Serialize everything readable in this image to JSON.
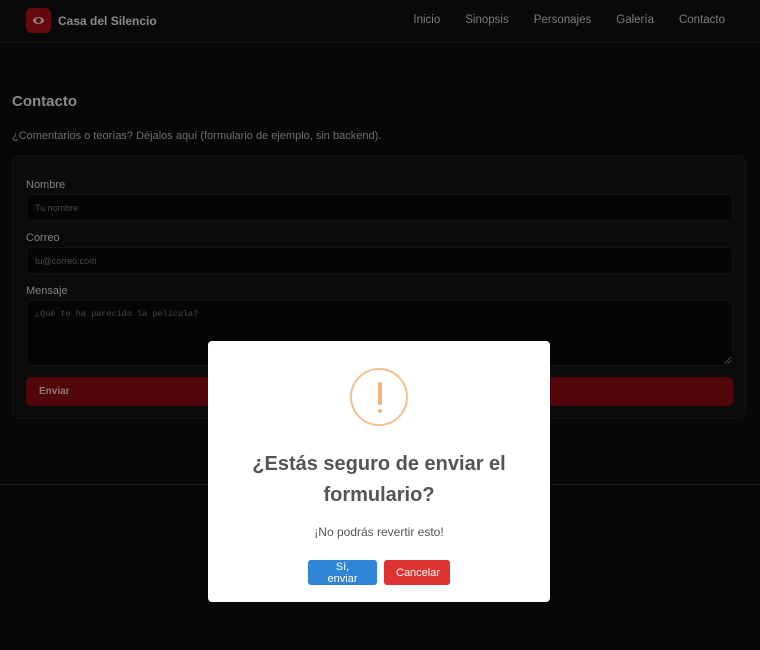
{
  "header": {
    "brand": "Casa del Silencio",
    "nav": [
      "Inicio",
      "Sinopsis",
      "Personajes",
      "Galería",
      "Contacto"
    ]
  },
  "contact": {
    "title": "Contacto",
    "description": "¿Comentarios o teorías? Déjalos aquí (formulario de ejemplo, sin backend).",
    "name_label": "Nombre",
    "name_placeholder": "Tu nombre",
    "email_label": "Correo",
    "email_placeholder": "tu@correo.com",
    "message_label": "Mensaje",
    "message_placeholder": "¿Qué te ha parecido la película?",
    "submit_label": "Enviar"
  },
  "dialog": {
    "icon": "warning-icon",
    "title": "¿Estás seguro de enviar el formulario?",
    "text": "¡No podrás revertir esto!",
    "confirm_label": "Sí, enviar",
    "cancel_label": "Cancelar"
  },
  "colors": {
    "accent": "#9c0e16",
    "confirm": "#3085d6",
    "cancel": "#dd3333",
    "warning": "#f8bb86"
  }
}
